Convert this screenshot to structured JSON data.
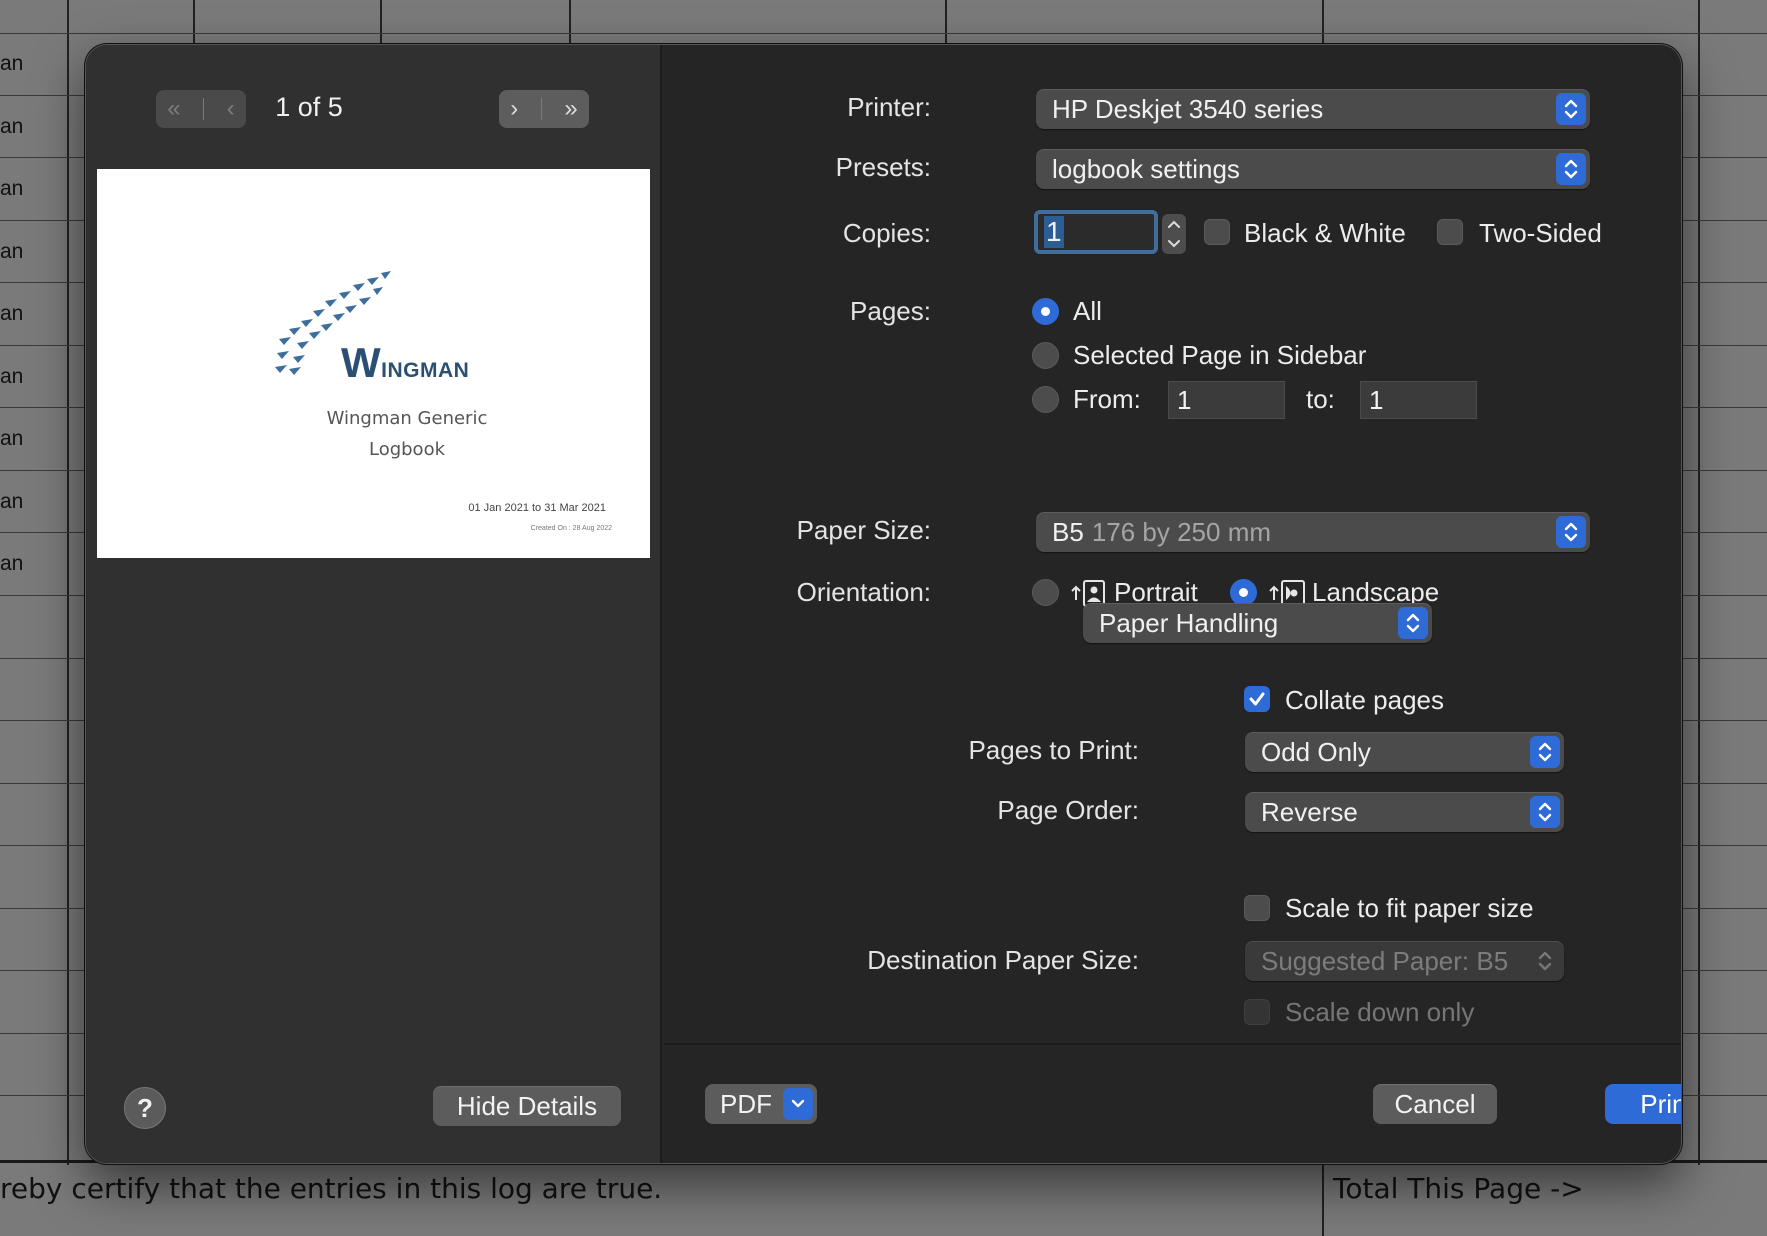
{
  "background": {
    "row_labels": [
      "an",
      "an",
      "an",
      "an",
      "an",
      "an",
      "an",
      "an",
      "an"
    ],
    "certify_text": "reby certify that the entries in this log are true.",
    "total_text": "Total This Page ->"
  },
  "sidebar": {
    "page_indicator": "1 of 5",
    "preview": {
      "logo_initial": "W",
      "logo_rest": "INGMAN",
      "title_line1": "Wingman Generic",
      "title_line2": "Logbook",
      "date_range": "01 Jan 2021 to 31 Mar 2021",
      "created_on": "Created On : 28 Aug 2022"
    },
    "help_label": "?",
    "hide_details_label": "Hide Details"
  },
  "printer": {
    "label": "Printer:",
    "value": "HP Deskjet 3540 series"
  },
  "presets": {
    "label": "Presets:",
    "value": "logbook settings"
  },
  "copies": {
    "label": "Copies:",
    "value": "1",
    "black_white_label": "Black & White",
    "black_white_checked": false,
    "two_sided_label": "Two-Sided",
    "two_sided_checked": false
  },
  "pages": {
    "label": "Pages:",
    "options": [
      "All",
      "Selected Page in Sidebar",
      "From:"
    ],
    "selected": "All",
    "from_value": "1",
    "to_label": "to:",
    "to_value": "1"
  },
  "paper_size": {
    "label": "Paper Size:",
    "value": "B5",
    "detail": "176 by 250 mm"
  },
  "orientation": {
    "label": "Orientation:",
    "portrait_label": "Portrait",
    "landscape_label": "Landscape",
    "selected": "Landscape"
  },
  "section_popup": {
    "value": "Paper Handling"
  },
  "paper_handling": {
    "collate_label": "Collate pages",
    "collate_checked": true,
    "pages_to_print_label": "Pages to Print:",
    "pages_to_print_value": "Odd Only",
    "page_order_label": "Page Order:",
    "page_order_value": "Reverse",
    "scale_fit_label": "Scale to fit paper size",
    "scale_fit_checked": false,
    "dest_size_label": "Destination Paper Size:",
    "dest_size_value": "Suggested Paper: B5",
    "scale_down_label": "Scale down only",
    "scale_down_checked": false
  },
  "footer": {
    "pdf_label": "PDF",
    "cancel_label": "Cancel",
    "print_label": "Print"
  },
  "colors": {
    "accent": "#2f6bd6",
    "dialog_bg": "#252525",
    "sidebar_bg": "#303030"
  }
}
